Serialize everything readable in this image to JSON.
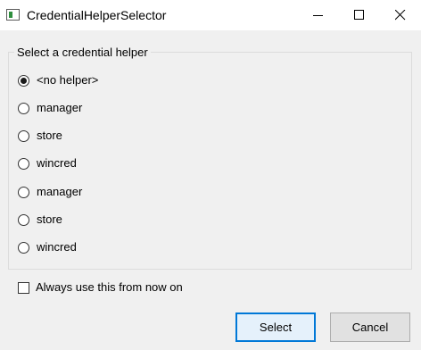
{
  "window": {
    "title": "CredentialHelperSelector"
  },
  "group": {
    "label": "Select a credential helper"
  },
  "helpers": [
    {
      "label": "<no helper>",
      "selected": true
    },
    {
      "label": "manager",
      "selected": false
    },
    {
      "label": "store",
      "selected": false
    },
    {
      "label": "wincred",
      "selected": false
    },
    {
      "label": "manager",
      "selected": false
    },
    {
      "label": "store",
      "selected": false
    },
    {
      "label": "wincred",
      "selected": false
    }
  ],
  "always_use": {
    "label": "Always use this from now on",
    "checked": false
  },
  "buttons": {
    "select": "Select",
    "cancel": "Cancel"
  }
}
